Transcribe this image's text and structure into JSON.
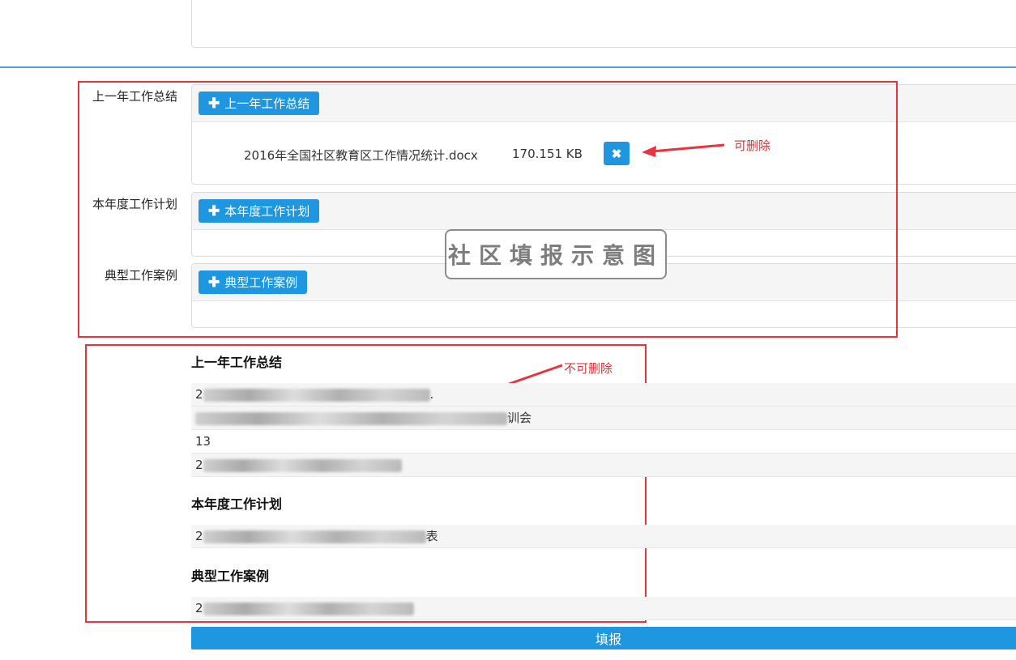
{
  "upload_section": {
    "rows": [
      {
        "label": "上一年工作总结",
        "button": "上一年工作总结"
      },
      {
        "label": "本年度工作计划",
        "button": "本年度工作计划"
      },
      {
        "label": "典型工作案例",
        "button": "典型工作案例"
      }
    ],
    "file": {
      "name": "2016年全国社区教育区工作情况统计.docx",
      "size": "170.151 KB"
    }
  },
  "annotations": {
    "deletable": "可删除",
    "not_deletable": "不可删除",
    "watermark": "社区填报示意图"
  },
  "view_section": {
    "summary_title": "上一年工作总结",
    "summary_items": [
      "2",
      "",
      "13",
      "2"
    ],
    "summary_tails": [
      ".",
      "训会",
      "",
      ""
    ],
    "plan_title": "本年度工作计划",
    "plan_items": [
      "2"
    ],
    "plan_tails": [
      "表"
    ],
    "case_title": "典型工作案例",
    "case_items": [
      "2"
    ]
  },
  "submit_label": "填报",
  "colors": {
    "accent": "#1f96e0",
    "highlight": "#e8343f",
    "divider": "#5aa0dc"
  }
}
